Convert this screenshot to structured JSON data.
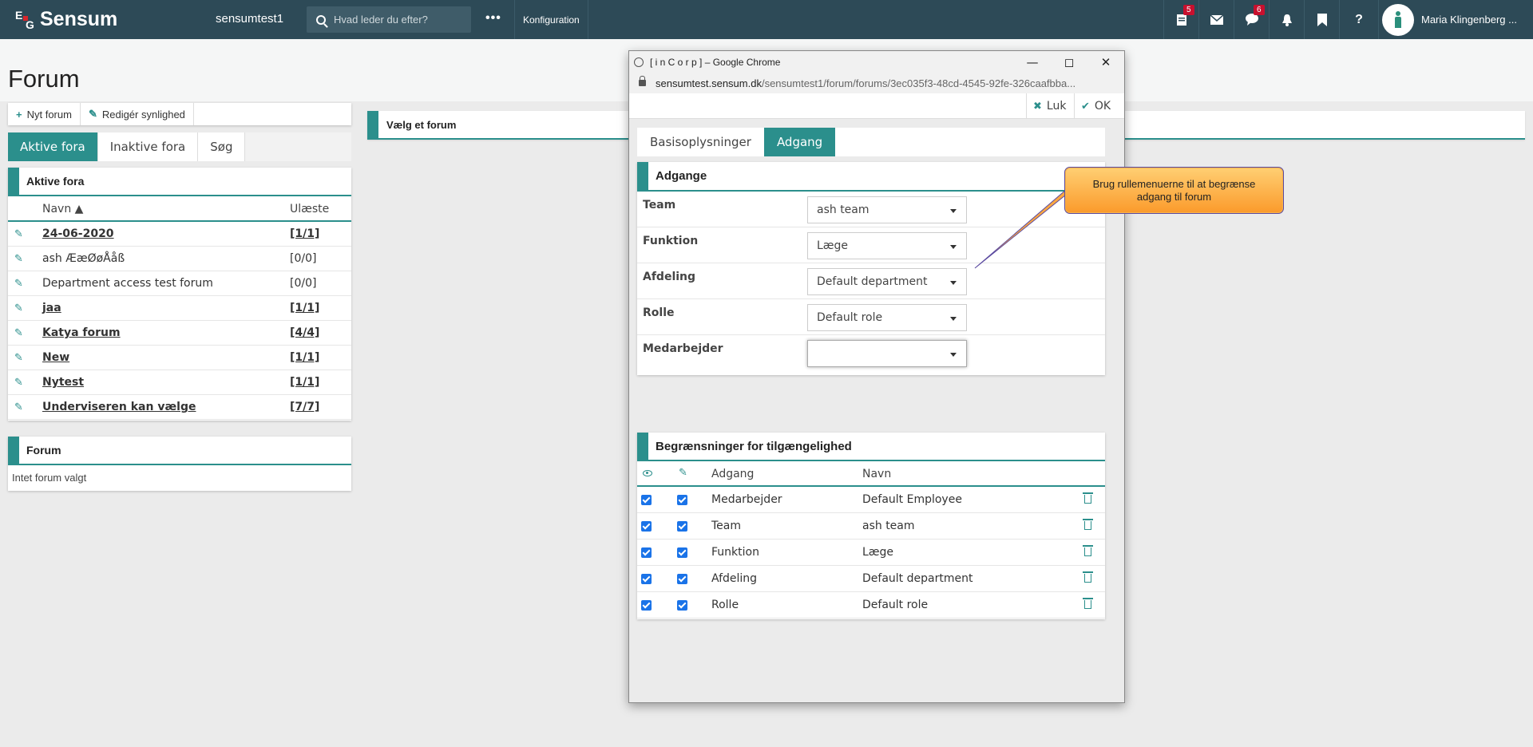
{
  "topbar": {
    "logo_text": "Sensum",
    "logo_mark_e": "E",
    "logo_mark_g": "G",
    "org_name": "sensumtest1",
    "search_placeholder": "Hvad leder du efter?",
    "more": "•••",
    "config_label": "Konfiguration",
    "tasks_badge": "5",
    "chat_badge": "6",
    "help": "?",
    "user_name": "Maria Klingenberg ..."
  },
  "page": {
    "title": "Forum"
  },
  "toolbar": {
    "new_forum": "Nyt forum",
    "edit_visibility": "Redigér synlighed"
  },
  "tabs": [
    "Aktive fora",
    "Inaktive fora",
    "Søg"
  ],
  "active_list": {
    "title": "Aktive fora",
    "col_name": "Navn ▲",
    "col_unread": "Ulæste",
    "rows": [
      {
        "name": "24-06-2020",
        "count": "[1/1]"
      },
      {
        "name": "ash ÆæØøÅåß",
        "count": "[0/0]"
      },
      {
        "name": "Department access test forum",
        "count": "[0/0]"
      },
      {
        "name": "jaa",
        "count": "[1/1]"
      },
      {
        "name": "Katya forum",
        "count": "[4/4]"
      },
      {
        "name": "New",
        "count": "[1/1]"
      },
      {
        "name": "Nytest",
        "count": "[1/1]"
      },
      {
        "name": "Underviseren kan vælge",
        "count": "[7/7]"
      }
    ]
  },
  "forum_panel": {
    "title": "Forum",
    "empty": "Intet forum valgt"
  },
  "right_panel": {
    "title": "Vælg et forum"
  },
  "popup": {
    "window_title": "[ i n C o r p ] – Google Chrome",
    "url_domain": "sensumtest.sensum.dk",
    "url_path": "/sensumtest1/forum/forums/3ec035f3-48cd-4545-92fe-326caafbba...",
    "btn_close": "Luk",
    "btn_ok": "OK",
    "tabs": [
      "Basisoplysninger",
      "Adgang"
    ],
    "access": {
      "title": "Adgange",
      "fields": [
        {
          "label": "Team",
          "value": "ash team"
        },
        {
          "label": "Funktion",
          "value": "Læge"
        },
        {
          "label": "Afdeling",
          "value": "Default department"
        },
        {
          "label": "Rolle",
          "value": "Default role"
        },
        {
          "label": "Medarbejder",
          "value": ""
        }
      ]
    },
    "restrictions": {
      "title": "Begrænsninger for tilgængelighed",
      "col_access": "Adgang",
      "col_name": "Navn",
      "rows": [
        {
          "access": "Medarbejder",
          "name": "Default Employee"
        },
        {
          "access": "Team",
          "name": "ash team"
        },
        {
          "access": "Funktion",
          "name": "Læge"
        },
        {
          "access": "Afdeling",
          "name": "Default department"
        },
        {
          "access": "Rolle",
          "name": "Default role"
        }
      ]
    }
  },
  "callout": {
    "text": "Brug rullemenuerne til at begrænse adgang til forum"
  },
  "colors": {
    "topbar": "#2d4a57",
    "accent": "#2b8f8c",
    "badge": "#c8102e",
    "callout": "#fb9a2b"
  }
}
